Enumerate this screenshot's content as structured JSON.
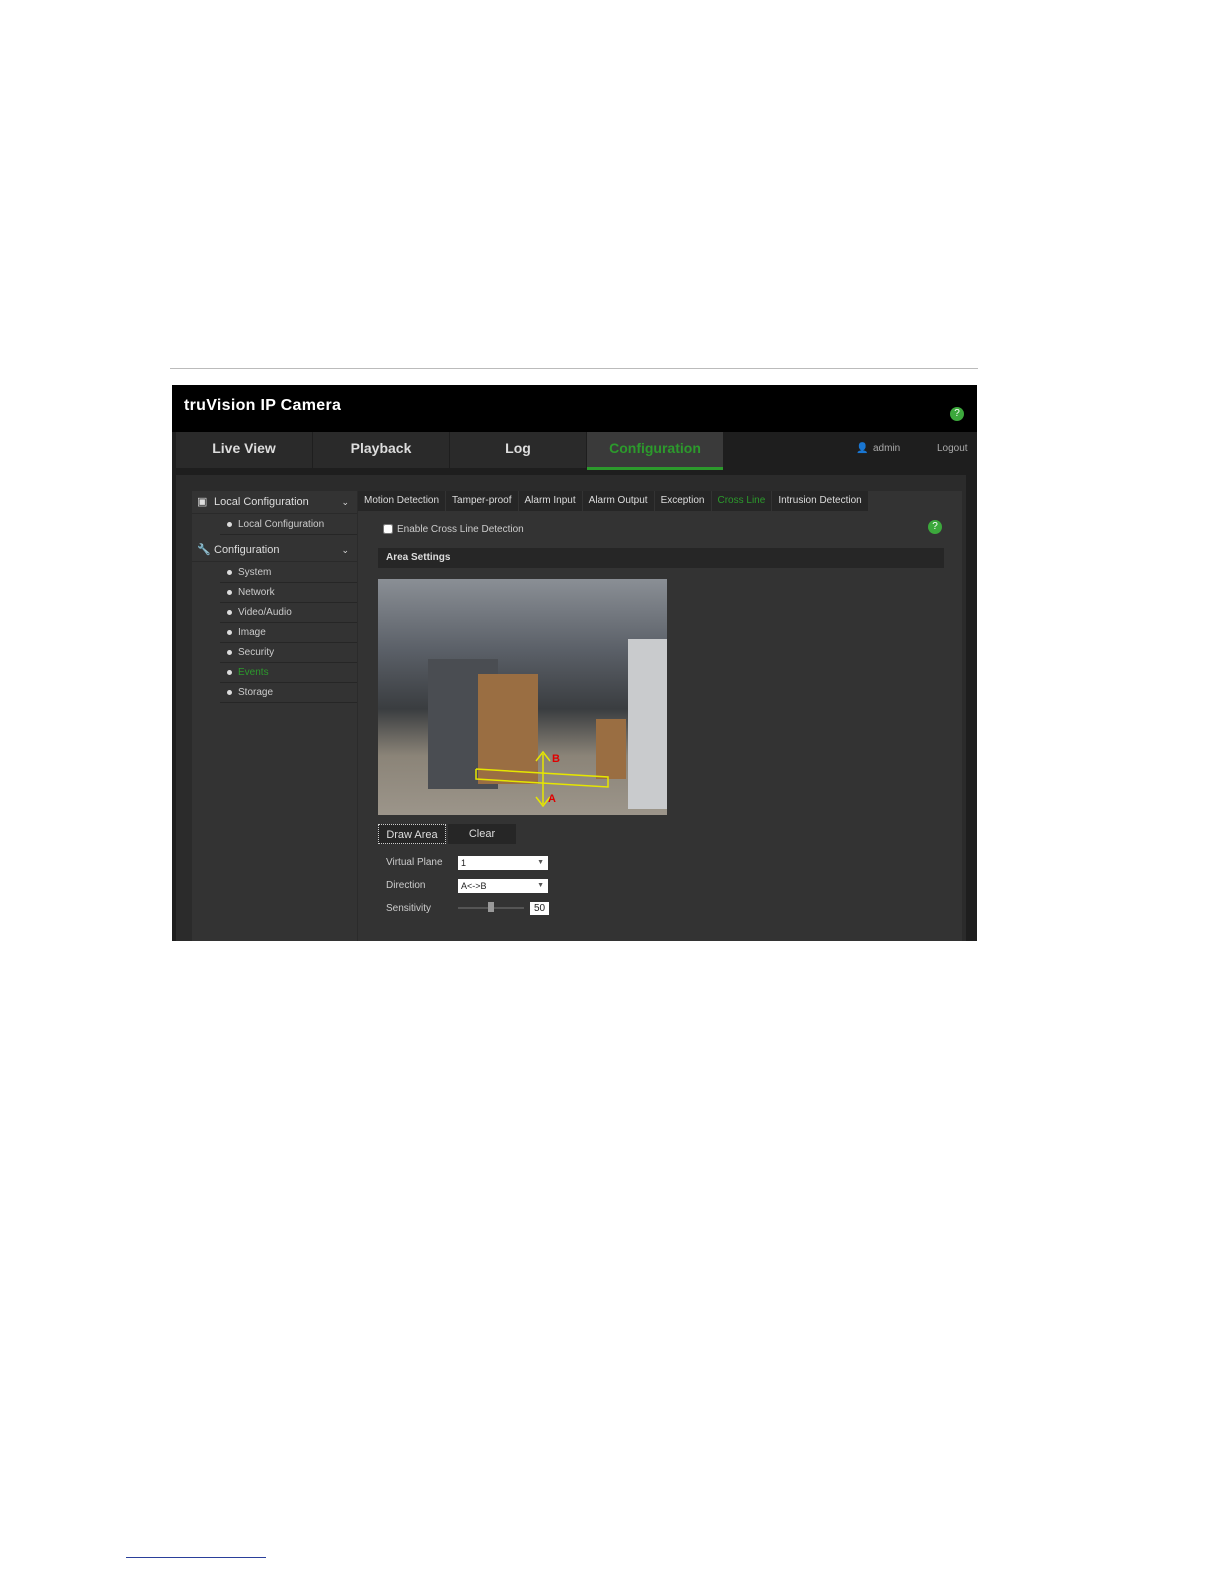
{
  "app": {
    "logo": "truVision IP Camera",
    "help": "?"
  },
  "nav": {
    "tabs": [
      "Live View",
      "Playback",
      "Log",
      "Configuration"
    ],
    "active": 3,
    "user": "admin",
    "logout": "Logout"
  },
  "sidebar": {
    "local_header": "Local Configuration",
    "local_items": [
      "Local Configuration"
    ],
    "config_header": "Configuration",
    "config_items": [
      "System",
      "Network",
      "Video/Audio",
      "Image",
      "Security",
      "Events",
      "Storage"
    ],
    "active": "Events"
  },
  "tabs": [
    "Motion Detection",
    "Tamper-proof",
    "Alarm Input",
    "Alarm Output",
    "Exception",
    "Cross Line",
    "Intrusion Detection"
  ],
  "active_tab": "Cross Line",
  "enable_label": "Enable Cross Line Detection",
  "enable_checked": false,
  "area_settings": "Area Settings",
  "overlay": {
    "a": "A",
    "b": "B"
  },
  "buttons": {
    "draw": "Draw Area",
    "clear": "Clear"
  },
  "fields": {
    "virtual_plane_label": "Virtual Plane",
    "virtual_plane": "1",
    "direction_label": "Direction",
    "direction": "A<->B",
    "sensitivity_label": "Sensitivity",
    "sensitivity": "50"
  },
  "colors": {
    "accent": "#2c9a2c",
    "overlay_line": "#e6e600",
    "overlay_text": "#e00000"
  }
}
